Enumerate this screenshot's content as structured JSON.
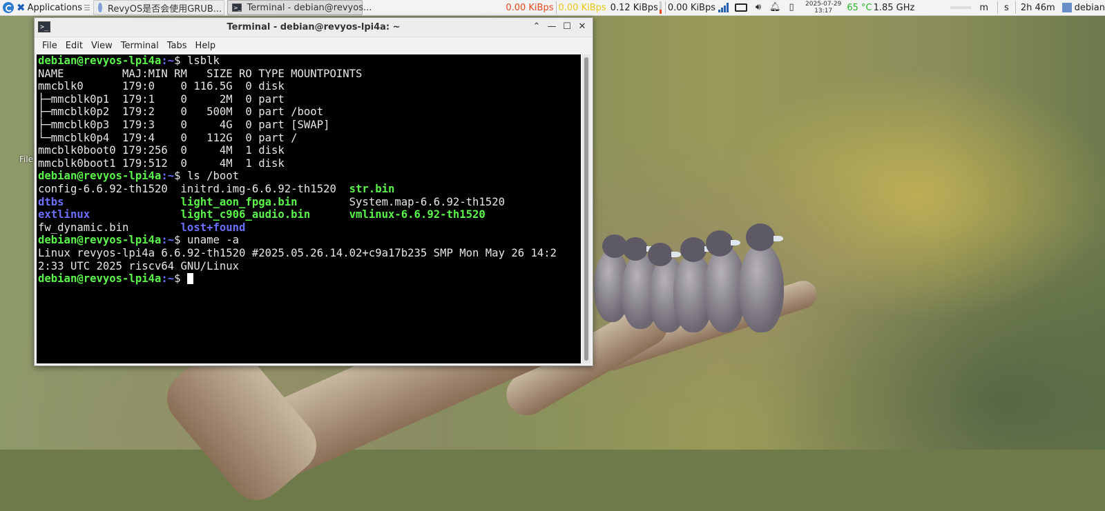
{
  "panel": {
    "applications_label": "Applications",
    "tasks": [
      {
        "label": "RevyOS是否会使用GRUB...",
        "icon": "chrome-icon"
      },
      {
        "label": "Terminal - debian@revyos...",
        "icon": "terminal-icon"
      }
    ],
    "net1": "0.00 KiBps",
    "net2_a": "0.00 KiBps",
    "net2_b": "0.12 KiBps",
    "net3": "0.00 KiBps",
    "date": "2025-07-29",
    "time": "13:17",
    "temperature": "65 °C",
    "cpu_freq": "1.85 GHz",
    "item_m": "m",
    "item_s": "s",
    "uptime": "2h 46m",
    "user": "debian",
    "colors": {
      "net_red": "#e8481d",
      "net_yellow": "#e9c817",
      "temp_green": "#26b526"
    }
  },
  "desktop": {
    "icon_label": "File"
  },
  "terminal": {
    "title": "Terminal - debian@revyos-lpi4a: ~",
    "menu": [
      "File",
      "Edit",
      "View",
      "Terminal",
      "Tabs",
      "Help"
    ],
    "prompt_user": "debian@revyos-lpi4a",
    "prompt_path": ":~",
    "prompt_sym": "$ ",
    "cmd_lsblk": "lsblk",
    "lsblk_lines": [
      "NAME         MAJ:MIN RM   SIZE RO TYPE MOUNTPOINTS",
      "mmcblk0      179:0    0 116.5G  0 disk",
      "├─mmcblk0p1  179:1    0     2M  0 part",
      "├─mmcblk0p2  179:2    0   500M  0 part /boot",
      "├─mmcblk0p3  179:3    0     4G  0 part [SWAP]",
      "└─mmcblk0p4  179:4    0   112G  0 part /",
      "mmcblk0boot0 179:256  0     4M  1 disk",
      "mmcblk0boot1 179:512  0     4M  1 disk"
    ],
    "cmd_ls": "ls /boot",
    "ls_rows": [
      [
        {
          "t": "config-6.6.92-th1520  ",
          "k": "file"
        },
        {
          "t": "initrd.img-6.6.92-th1520  ",
          "k": "file"
        },
        {
          "t": "str.bin",
          "k": "exec"
        }
      ],
      [
        {
          "t": "dtbs                  ",
          "k": "dir"
        },
        {
          "t": "light_aon_fpga.bin        ",
          "k": "exec"
        },
        {
          "t": "System.map-6.6.92-th1520",
          "k": "file"
        }
      ],
      [
        {
          "t": "extlinux              ",
          "k": "dir"
        },
        {
          "t": "light_c906_audio.bin      ",
          "k": "exec"
        },
        {
          "t": "vmlinux-6.6.92-th1520",
          "k": "exec"
        }
      ],
      [
        {
          "t": "fw_dynamic.bin        ",
          "k": "file"
        },
        {
          "t": "lost+found",
          "k": "dir"
        }
      ]
    ],
    "cmd_uname": "uname -a",
    "uname_lines": [
      "Linux revyos-lpi4a 6.6.92-th1520 #2025.05.26.14.02+c9a17b235 SMP Mon May 26 14:2",
      "2:33 UTC 2025 riscv64 GNU/Linux"
    ]
  }
}
